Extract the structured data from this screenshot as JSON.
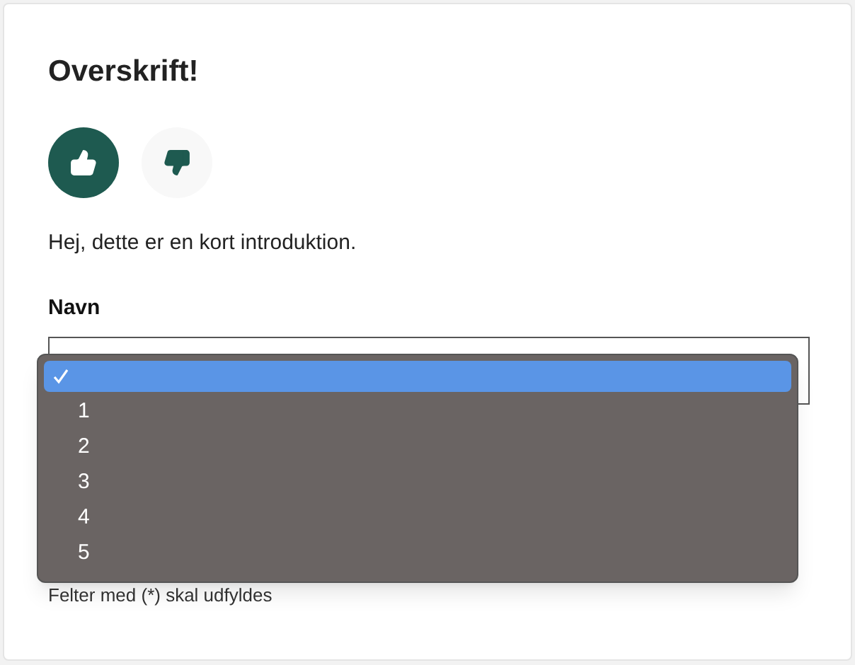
{
  "title": "Overskrift!",
  "reactions": [
    {
      "kind": "up",
      "selected": true
    },
    {
      "kind": "down",
      "selected": false
    }
  ],
  "intro": "Hej, dette er en kort introduktion.",
  "field": {
    "label": "Navn",
    "dropdown_open": true,
    "options": [
      {
        "selected": true
      },
      {
        "label": "1",
        "selected": false
      },
      {
        "label": "2",
        "selected": false
      },
      {
        "label": "3",
        "selected": false
      },
      {
        "label": "4",
        "selected": false
      },
      {
        "label": "5",
        "selected": false
      }
    ]
  },
  "footnote": "Felter med (*) skal udfyldes"
}
